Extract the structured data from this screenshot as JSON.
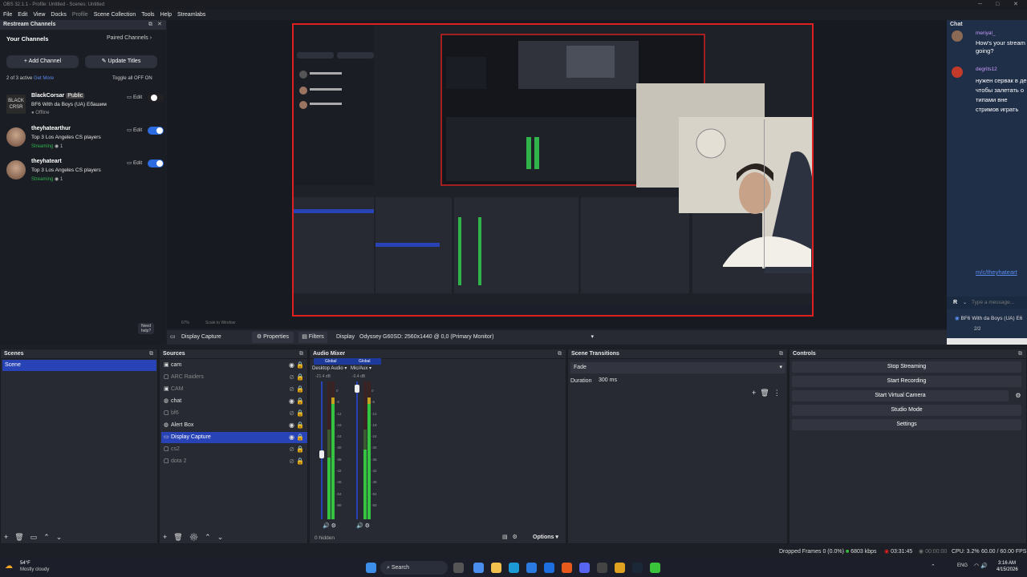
{
  "window": {
    "title": "OBS 32.1.1 - Profile: Untitled - Scenes: Untitled"
  },
  "menu": [
    "File",
    "Edit",
    "View",
    "Docks",
    "Profile",
    "Scene Collection",
    "Tools",
    "Help",
    "Streamlabs"
  ],
  "restream": {
    "title": "Restream Channels",
    "your_channels": "Your Channels",
    "paired_channels": "Paired Channels",
    "add_channel": "Add Channel",
    "update_titles": "Update Titles",
    "active_count": "2 of 3 active",
    "get_more": "Get More",
    "toggle_all": "Toggle all OFF  ON",
    "channels": [
      {
        "name": "BlackCorsar",
        "badge": "Public",
        "desc": "BF6 With da Boys (UA) Ебашим",
        "status": "Offline",
        "viewers": "",
        "edit": "Edit",
        "enabled": false
      },
      {
        "name": "theyhatearthur",
        "badge": "",
        "desc": "Top 3 Los Angeles CS players",
        "status": "Streaming",
        "viewers": "1",
        "edit": "Edit",
        "enabled": true
      },
      {
        "name": "theyhateart",
        "badge": "",
        "desc": "Top 3 Los Angeles CS players",
        "status": "Streaming",
        "viewers": "1",
        "edit": "Edit",
        "enabled": true
      }
    ],
    "need_help": "Need help?"
  },
  "chat": {
    "title": "Chat",
    "messages": [
      {
        "user": "meriyal_",
        "text": "How's your stream going?"
      },
      {
        "user": "degrits12",
        "text": "нужен сервак в де чтобы залетать о типами вне стримов играть"
      }
    ],
    "link": "m/c/theyhateart",
    "placeholder": "Type a message...",
    "footer": "BF6 With da Boys (UA) E6",
    "counts": "2/2"
  },
  "preview": {
    "zoom": "67%",
    "scale_label": "Scale to Window"
  },
  "source_toolbar": {
    "source": "Display Capture",
    "properties": "Properties",
    "filters": "Filters",
    "display_label": "Display",
    "display_value": "Odyssey G60SD: 2560x1440 @ 0,0 (Primary Monitor)"
  },
  "scenes": {
    "title": "Scenes",
    "items": [
      "Scene"
    ]
  },
  "sources": {
    "title": "Sources",
    "items": [
      {
        "name": "cam",
        "dim": false,
        "icon": "camera"
      },
      {
        "name": "ARC Raiders",
        "dim": true,
        "icon": "game"
      },
      {
        "name": "CAM",
        "dim": true,
        "icon": "camera"
      },
      {
        "name": "chat",
        "dim": false,
        "icon": "browser"
      },
      {
        "name": "bf6",
        "dim": true,
        "icon": "game"
      },
      {
        "name": "Alert Box",
        "dim": false,
        "icon": "browser"
      },
      {
        "name": "Display Capture",
        "dim": false,
        "icon": "monitor",
        "selected": true
      },
      {
        "name": "cs2",
        "dim": true,
        "icon": "game"
      },
      {
        "name": "dota 2",
        "dim": true,
        "icon": "game"
      }
    ]
  },
  "mixer": {
    "title": "Audio Mixer",
    "channels": [
      {
        "label": "Global",
        "name": "Desktop Audio",
        "db": "-21.4 dB",
        "volume": 0.55
      },
      {
        "label": "Global",
        "name": "Mic/Aux",
        "db": "-0.4 dB",
        "volume": 0.98
      }
    ],
    "scale": [
      "0",
      "-6",
      "-12",
      "-18",
      "-24",
      "-30",
      "-36",
      "-42",
      "-48",
      "-54",
      "-60"
    ],
    "hidden": "0 hidden",
    "options": "Options"
  },
  "transitions": {
    "title": "Scene Transitions",
    "type": "Fade",
    "duration_label": "Duration",
    "duration_value": "300 ms"
  },
  "controls": {
    "title": "Controls",
    "buttons": [
      "Stop Streaming",
      "Start Recording",
      "Start Virtual Camera",
      "Studio Mode",
      "Settings"
    ]
  },
  "status": {
    "dropped": "Dropped Frames 0 (0.0%)",
    "kbps": "6803 kbps",
    "stream_time": "03:31:45",
    "rec_time": "00:00:00",
    "cpu": "CPU: 3.2%",
    "fps": "60.00 / 60.00 FPS"
  },
  "taskbar": {
    "weather_temp": "54°F",
    "weather_desc": "Mostly cloudy",
    "search": "Search",
    "lang": "ENG",
    "time": "3:16 AM",
    "date": "4/15/2026"
  },
  "colors": {
    "accent": "#2843b5",
    "preview_border": "#e02020",
    "streaming": "#2fb34a"
  }
}
